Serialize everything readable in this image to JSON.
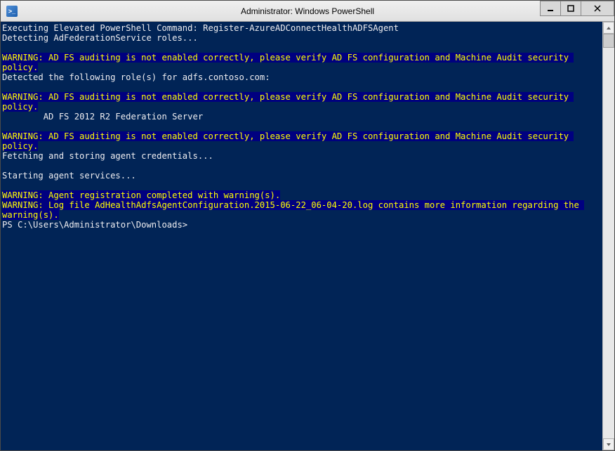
{
  "window": {
    "title": "Administrator: Windows PowerShell"
  },
  "console": {
    "lines": [
      {
        "type": "normal",
        "text": "Executing Elevated PowerShell Command: Register-AzureADConnectHealthADFSAgent"
      },
      {
        "type": "normal",
        "text": "Detecting AdFederationService roles..."
      },
      {
        "type": "normal",
        "text": ""
      },
      {
        "type": "warning",
        "text": "WARNING: AD FS auditing is not enabled correctly, please verify AD FS configuration and Machine Audit security policy."
      },
      {
        "type": "normal",
        "text": "Detected the following role(s) for adfs.contoso.com:"
      },
      {
        "type": "normal",
        "text": ""
      },
      {
        "type": "warning",
        "text": "WARNING: AD FS auditing is not enabled correctly, please verify AD FS configuration and Machine Audit security policy."
      },
      {
        "type": "normal",
        "text": "        AD FS 2012 R2 Federation Server"
      },
      {
        "type": "normal",
        "text": ""
      },
      {
        "type": "warning",
        "text": "WARNING: AD FS auditing is not enabled correctly, please verify AD FS configuration and Machine Audit security policy."
      },
      {
        "type": "normal",
        "text": "Fetching and storing agent credentials..."
      },
      {
        "type": "normal",
        "text": ""
      },
      {
        "type": "normal",
        "text": "Starting agent services..."
      },
      {
        "type": "normal",
        "text": ""
      },
      {
        "type": "warning",
        "text": "WARNING: Agent registration completed with warning(s)."
      },
      {
        "type": "warning",
        "text": "WARNING: Log file AdHealthAdfsAgentConfiguration.2015-06-22_06-04-20.log contains more information regarding the "
      },
      {
        "type": "warning",
        "text": "warning(s)."
      },
      {
        "type": "normal",
        "text": "PS C:\\Users\\Administrator\\Downloads>"
      }
    ]
  }
}
